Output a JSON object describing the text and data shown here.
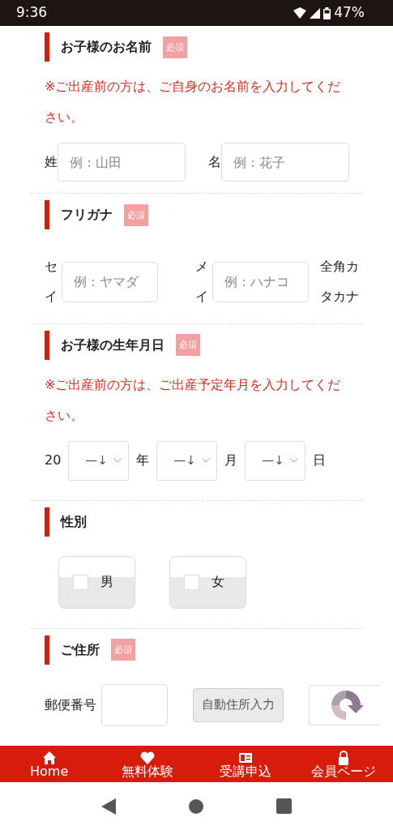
{
  "status_bar": {
    "time": "9:36",
    "battery": "47%"
  },
  "sections": [
    {
      "kind": "name",
      "title": "お子様のお名前",
      "badge": "必須",
      "note": "※ご出産前の方は、ご自身のお名前を入力してください。",
      "fields": [
        {
          "label": "姓",
          "placeholder": "例：山田"
        },
        {
          "label": "名",
          "placeholder": "例：花子"
        }
      ]
    },
    {
      "kind": "kana",
      "title": "フリガナ",
      "badge": "必須",
      "fields": [
        {
          "label": "セイ",
          "placeholder": "例：ヤマダ"
        },
        {
          "label": "メイ",
          "placeholder": "例：ハナコ"
        }
      ],
      "suffix": "全角カタカナ"
    },
    {
      "kind": "date",
      "title": "お子様の生年月日",
      "badge": "必須",
      "note": "※ご出産前の方は、ご出産予定年月を入力してください。",
      "prefix": "20",
      "selects": [
        {
          "value": "—↓",
          "unit": "年"
        },
        {
          "value": "—↓",
          "unit": "月"
        },
        {
          "value": "—↓",
          "unit": "日"
        }
      ]
    },
    {
      "kind": "gender",
      "title": "性別",
      "options": [
        {
          "label": "男",
          "checked": false
        },
        {
          "label": "女",
          "checked": false
        }
      ]
    },
    {
      "kind": "address",
      "title": "ご住所",
      "badge": "必須",
      "label": "郵便番号",
      "button": "自動住所入力"
    }
  ],
  "bottom_nav": [
    {
      "label": "Home"
    },
    {
      "label": "無料体験"
    },
    {
      "label": "受講申込"
    },
    {
      "label": "会員ページ"
    }
  ]
}
